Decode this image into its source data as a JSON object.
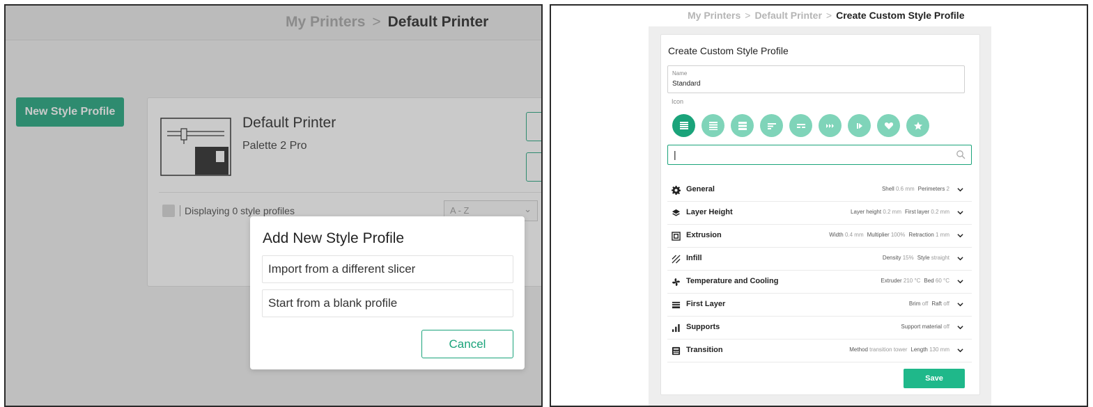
{
  "left_panel": {
    "breadcrumb": {
      "parent": "My Printers",
      "separator": ">",
      "current": "Default Printer"
    },
    "new_style_profile_button": "New Style Profile",
    "printer_card": {
      "name": "Default Printer",
      "model": "Palette 2 Pro",
      "profile_count_text": "Displaying 0 style profiles",
      "sort_value": "A - Z"
    },
    "modal": {
      "title": "Add New Style Profile",
      "options": [
        "Import from a different slicer",
        "Start from a blank profile"
      ],
      "cancel_label": "Cancel"
    }
  },
  "right_panel": {
    "breadcrumb": {
      "items": [
        "My Printers",
        "Default Printer"
      ],
      "separator": ">",
      "current": "Create Custom Style Profile"
    },
    "title": "Create Custom Style Profile",
    "name_field": {
      "label": "Name",
      "value": "Standard"
    },
    "icon_label": "Icon",
    "icons": [
      {
        "name": "lines-dense-icon",
        "selected": true
      },
      {
        "name": "lines-medium-icon",
        "selected": false
      },
      {
        "name": "lines-thick-icon",
        "selected": false
      },
      {
        "name": "lines-short-icon",
        "selected": false
      },
      {
        "name": "lines-split-icon",
        "selected": false
      },
      {
        "name": "fast-forward-icon",
        "selected": false
      },
      {
        "name": "play-step-icon",
        "selected": false
      },
      {
        "name": "heart-icon",
        "selected": false
      },
      {
        "name": "star-icon",
        "selected": false
      }
    ],
    "search": {
      "value": ""
    },
    "settings": [
      {
        "name": "General",
        "icon": "gear-icon",
        "summary": [
          [
            "Shell",
            "0.6 mm"
          ],
          [
            "Perimeters",
            "2"
          ]
        ]
      },
      {
        "name": "Layer Height",
        "icon": "layers-icon",
        "summary": [
          [
            "Layer height",
            "0.2 mm"
          ],
          [
            "First layer",
            "0.2 mm"
          ]
        ]
      },
      {
        "name": "Extrusion",
        "icon": "extrusion-icon",
        "summary": [
          [
            "Width",
            "0.4 mm"
          ],
          [
            "Multiplier",
            "100%"
          ],
          [
            "Retraction",
            "1 mm"
          ]
        ]
      },
      {
        "name": "Infill",
        "icon": "infill-icon",
        "summary": [
          [
            "Density",
            "15%"
          ],
          [
            "Style",
            "straight"
          ]
        ]
      },
      {
        "name": "Temperature and Cooling",
        "icon": "fan-icon",
        "summary": [
          [
            "Extruder",
            "210 °C"
          ],
          [
            "Bed",
            "60 °C"
          ]
        ]
      },
      {
        "name": "First Layer",
        "icon": "first-layer-icon",
        "summary": [
          [
            "Brim",
            "off"
          ],
          [
            "Raft",
            "off"
          ]
        ]
      },
      {
        "name": "Supports",
        "icon": "supports-icon",
        "summary": [
          [
            "Support material",
            "off"
          ]
        ]
      },
      {
        "name": "Transition",
        "icon": "transition-icon",
        "summary": [
          [
            "Method",
            "transition tower"
          ],
          [
            "Length",
            "130 mm"
          ]
        ]
      }
    ],
    "save_label": "Save"
  },
  "colors": {
    "accent": "#1aa37a",
    "accent_light": "#7fd4b9",
    "save": "#1fb88a"
  }
}
